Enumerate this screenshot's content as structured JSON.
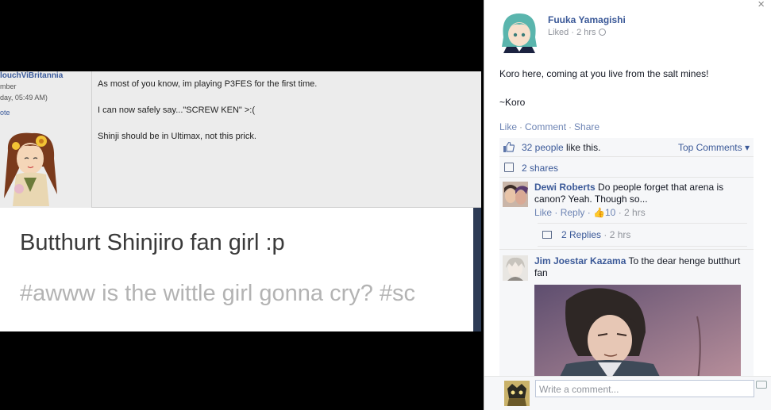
{
  "forum": {
    "username": "louchViBritannia",
    "rank": "mber",
    "date": "day, 05:49 AM)",
    "quote": "ote",
    "post_lines": [
      "As most of you know, im playing P3FES for the first time.",
      "I can now safely say...\"SCREW KEN\" >:(",
      "Shinji should be in Ultimax, not this prick."
    ]
  },
  "tagbox": {
    "title": "Butthurt Shinjiro fan girl :p",
    "tags": "#awww is the wittle girl gonna cry?   #sc"
  },
  "facebook": {
    "close": "×",
    "poster": "Fuuka Yamagishi",
    "meta": "Liked · 2 hrs",
    "status_line1": "Koro here, coming at you live from the salt mines!",
    "status_line2": "~Koro",
    "actions": {
      "like": "Like",
      "comment": "Comment",
      "share": "Share"
    },
    "likes_count": "32 people",
    "likes_suffix": " like this.",
    "top_comments": "Top Comments ▾",
    "shares": "2 shares",
    "comments": [
      {
        "name": "Dewi Roberts",
        "text": " Do people forget that arena is canon? Yeah. Though so...",
        "like": "Like",
        "reply": "Reply",
        "likes": "10",
        "time": "2 hrs",
        "replies": "2 Replies",
        "replies_time": "2 hrs"
      },
      {
        "name": "Jim Joestar Kazama",
        "text": " To the dear henge butthurt fan"
      }
    ],
    "write_placeholder": "Write a comment..."
  },
  "colors": {
    "fb_blue": "#3b5998",
    "fb_link": "#6d84b4",
    "gray_text": "#90949c"
  }
}
